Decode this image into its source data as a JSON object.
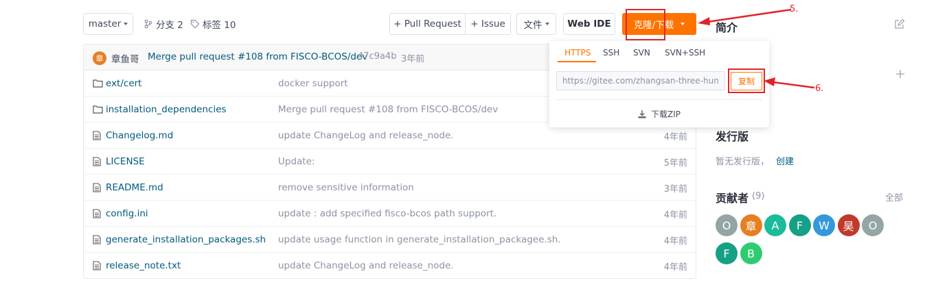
{
  "toolbar": {
    "branch": "master",
    "branches": "分支 2",
    "tags": "标签 10",
    "pull_request": "+ Pull Request",
    "issue": "+ Issue",
    "files": "文件",
    "web_ide": "Web IDE",
    "clone": "克隆/下载"
  },
  "commit": {
    "avatar_char": "章",
    "author": "章鱼哥",
    "message": "Merge pull request #108 from FISCO-BCOS/dev",
    "hash": "47c9a4b",
    "time": "3年前"
  },
  "files": [
    {
      "type": "folder",
      "name": "ext/cert",
      "message": "docker support",
      "time": ""
    },
    {
      "type": "folder",
      "name": "installation_dependencies",
      "message": "Merge pull request #108 from FISCO-BCOS/dev",
      "time": ""
    },
    {
      "type": "file",
      "name": "Changelog.md",
      "message": "update ChangeLog and release_node.",
      "time": "4年前"
    },
    {
      "type": "file",
      "name": "LICENSE",
      "message": "Update:",
      "time": "5年前"
    },
    {
      "type": "file",
      "name": "README.md",
      "message": "remove sensitive information",
      "time": "3年前"
    },
    {
      "type": "file",
      "name": "config.ini",
      "message": "update : add specified fisco-bcos path support.",
      "time": "4年前"
    },
    {
      "type": "file",
      "name": "generate_installation_packages.sh",
      "message": "update usage function in generate_installation_packagee.sh.",
      "time": "4年前"
    },
    {
      "type": "file",
      "name": "release_note.txt",
      "message": "update ChangeLog and release_node.",
      "time": "4年前"
    }
  ],
  "clone_dropdown": {
    "tabs": [
      "HTTPS",
      "SSH",
      "SVN",
      "SVN+SSH"
    ],
    "active_tab": "HTTPS",
    "url": "https://gitee.com/zhangsan-three-hun",
    "copy": "复制",
    "download_zip": "下载ZIP"
  },
  "sidebar": {
    "intro": "简介",
    "releases_title": "发行版",
    "releases_empty": "暂无发行版，",
    "create": "创建",
    "contributors_title": "贡献者",
    "contributors_count": "(9)",
    "all": "全部",
    "contributors": [
      {
        "char": "O",
        "color": "#95a5a6"
      },
      {
        "char": "章",
        "color": "#e67e22"
      },
      {
        "char": "A",
        "color": "#1abc9c"
      },
      {
        "char": "F",
        "color": "#16a085"
      },
      {
        "char": "W",
        "color": "#3498db"
      },
      {
        "char": "昊",
        "color": "#c0392b"
      },
      {
        "char": "O",
        "color": "#95a5a6"
      },
      {
        "char": "F",
        "color": "#16a085"
      },
      {
        "char": "B",
        "color": "#2ecc71"
      }
    ]
  },
  "annotations": {
    "step5": "5.",
    "step6": "6."
  },
  "colors": {
    "accent": "#fe7300",
    "link": "#005980",
    "annotation_red": "#e0242b"
  }
}
